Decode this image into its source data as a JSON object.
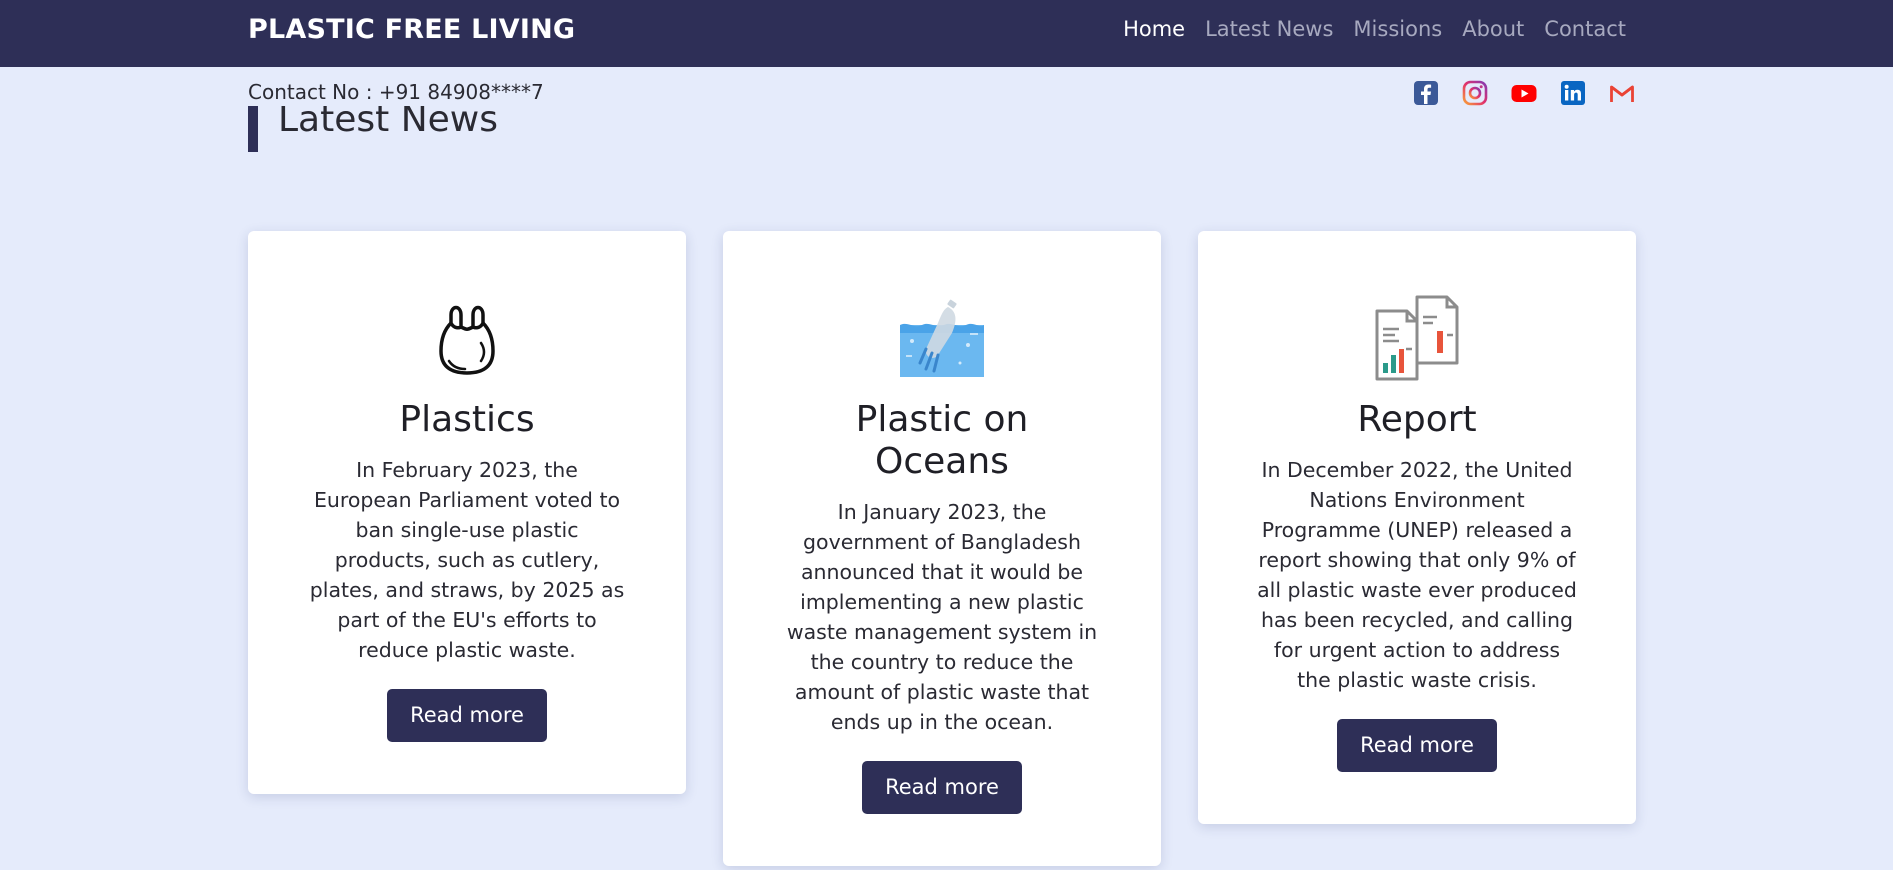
{
  "brand": "PLASTIC FREE LIVING",
  "nav": [
    "Home",
    "Latest News",
    "Missions",
    "About",
    "Contact"
  ],
  "contact": "Contact No : +91 84908****7",
  "socials": [
    "facebook-icon",
    "instagram-icon",
    "youtube-icon",
    "linkedin-icon",
    "gmail-icon"
  ],
  "section_heading": "Latest News",
  "cards": [
    {
      "icon": "plastic-bag-icon",
      "title": "Plastics",
      "text": "In February 2023, the European Parliament voted to ban single-use plastic products, such as cutlery, plates, and straws, by 2025 as part of the EU's efforts to reduce plastic waste.",
      "button": "Read more"
    },
    {
      "icon": "ocean-bottle-icon",
      "title": "Plastic on Oceans",
      "text": "In January 2023, the government of Bangladesh announced that it would be implementing a new plastic waste management system in the country to reduce the amount of plastic waste that ends up in the ocean.",
      "button": "Read more"
    },
    {
      "icon": "report-icon",
      "title": "Report",
      "text": "In December 2022, the United Nations Environment Programme (UNEP) released a report showing that only 9% of all plastic waste ever produced has been recycled, and calling for urgent action to address the plastic waste crisis.",
      "button": "Read more"
    }
  ],
  "colors": {
    "navbar": "#2e2f57",
    "background": "#e5ebfb",
    "button": "#2e2f57"
  }
}
